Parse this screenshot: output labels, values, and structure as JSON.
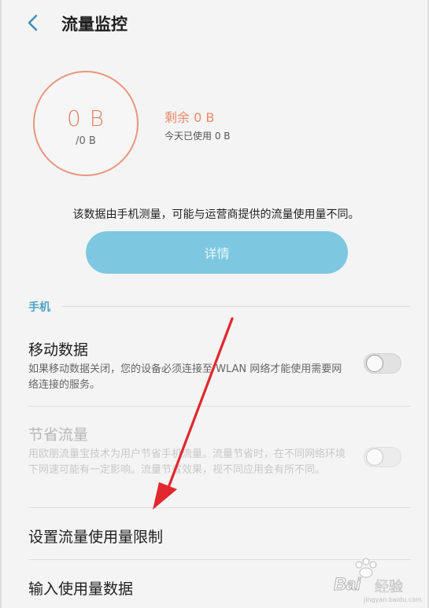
{
  "header": {
    "title": "流量监控"
  },
  "usage": {
    "used": "0 B",
    "total": "/0 B",
    "remaining": "剩余 0 B",
    "today": "今天已使用 0 B"
  },
  "notice": "该数据由手机测量，可能与运营商提供的流量使用量不同。",
  "details_button": "详情",
  "section": {
    "label": "手机"
  },
  "mobile_data": {
    "title": "移动数据",
    "desc": "如果移动数据关闭，您的设备必须连接至 WLAN 网络才能使用需要网络连接的服务。",
    "enabled": false
  },
  "data_saver": {
    "title": "节省流量",
    "desc": "用欧朋流量宝技术为用户节省手机流量。流量节省时，在不同网络环境下网速可能有一定影响。流量节省效果，视不同应用会有所不同。",
    "enabled": false
  },
  "set_limit": {
    "title": "设置流量使用量限制"
  },
  "input_usage": {
    "title": "输入使用量数据"
  },
  "watermark": {
    "brand": "Bai",
    "cn": "经验",
    "sub": "jingyan.baidu.com"
  },
  "colors": {
    "accent": "#4aa3c7",
    "ring": "#e9967e",
    "button": "#7dc8e0",
    "arrow": "#e0282e"
  }
}
